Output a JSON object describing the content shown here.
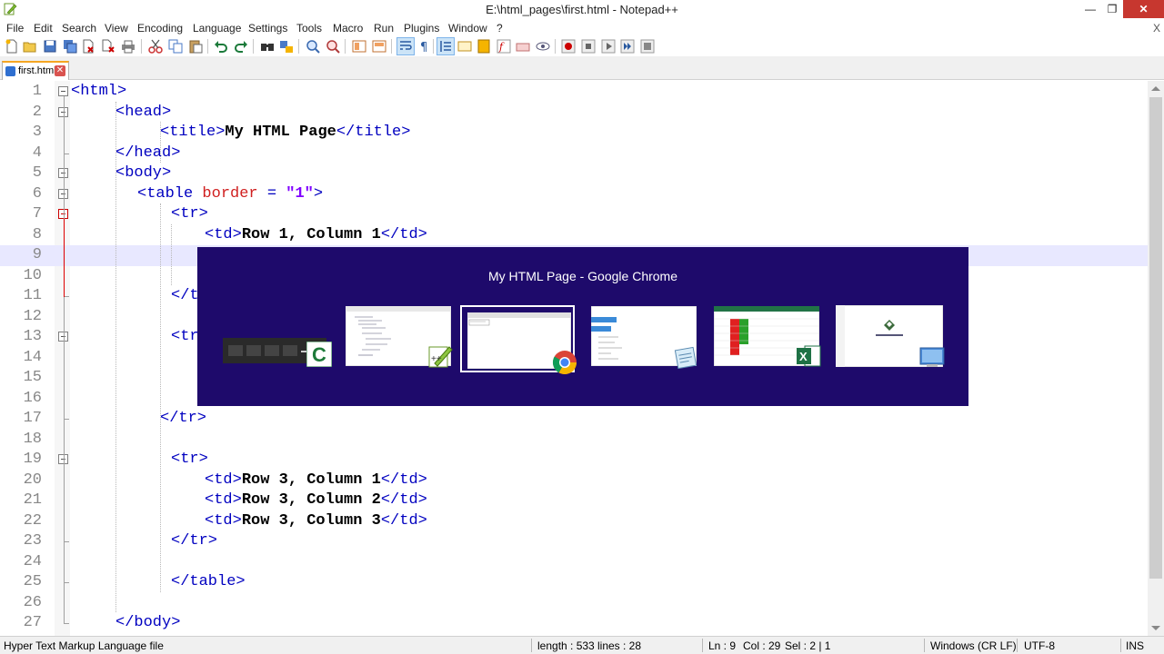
{
  "window": {
    "title": "E:\\html_pages\\first.html - Notepad++",
    "buttons": {
      "minimize": "—",
      "maximize": "❐",
      "close": "✕"
    }
  },
  "menu": {
    "items": [
      "File",
      "Edit",
      "Search",
      "View",
      "Encoding",
      "Language",
      "Settings",
      "Tools",
      "Macro",
      "Run",
      "Plugins",
      "Window",
      "?"
    ],
    "close": "X"
  },
  "toolbar": {
    "icons": [
      "new-file-icon",
      "open-file-icon",
      "save-icon",
      "save-all-icon",
      "close-icon",
      "close-all-icon",
      "print-icon",
      "cut-icon",
      "copy-icon",
      "paste-icon",
      "undo-icon",
      "redo-icon",
      "find-icon",
      "replace-icon",
      "zoom-in-icon",
      "zoom-out-icon",
      "sync-vertical-icon",
      "sync-horizontal-icon",
      "word-wrap-icon",
      "show-all-chars-icon",
      "indent-guide-icon",
      "udl-icon",
      "doc-map-icon",
      "function-list-icon",
      "folder-as-workspace-icon",
      "monitor-icon",
      "record-macro-icon",
      "stop-macro-icon",
      "play-macro-icon",
      "run-macro-multiple-icon",
      "save-macro-icon"
    ]
  },
  "tabs": [
    {
      "label": "first.html",
      "close": "✕"
    }
  ],
  "editor": {
    "current_line": 9,
    "lines": [
      {
        "n": "1",
        "segments": [
          {
            "c": "tag",
            "t": "<html>"
          }
        ]
      },
      {
        "n": "2",
        "segments": [
          {
            "c": "tag",
            "t": "<head>"
          }
        ]
      },
      {
        "n": "3",
        "segments": [
          {
            "c": "tag",
            "t": "<title>"
          },
          {
            "c": "txt",
            "t": "My HTML Page"
          },
          {
            "c": "tag",
            "t": "</title>"
          }
        ]
      },
      {
        "n": "4",
        "segments": [
          {
            "c": "tag",
            "t": "</head>"
          }
        ]
      },
      {
        "n": "5",
        "segments": [
          {
            "c": "tag",
            "t": "<body>"
          }
        ]
      },
      {
        "n": "6",
        "segments": [
          {
            "c": "tag",
            "t": "<table "
          },
          {
            "c": "attr",
            "t": "border"
          },
          {
            "c": "tag",
            "t": " = "
          },
          {
            "c": "val",
            "t": "\"1\""
          },
          {
            "c": "tag",
            "t": ">"
          }
        ]
      },
      {
        "n": "7",
        "segments": [
          {
            "c": "tag",
            "t": "<tr>"
          }
        ]
      },
      {
        "n": "8",
        "segments": [
          {
            "c": "tag",
            "t": "<td>"
          },
          {
            "c": "txt",
            "t": "Row 1, Column 1"
          },
          {
            "c": "tag",
            "t": "</td>"
          }
        ]
      },
      {
        "n": "9",
        "segments": []
      },
      {
        "n": "10",
        "segments": []
      },
      {
        "n": "11",
        "segments": [
          {
            "c": "tag",
            "t": "</tr>"
          }
        ]
      },
      {
        "n": "12",
        "segments": []
      },
      {
        "n": "13",
        "segments": [
          {
            "c": "tag",
            "t": "<tr>"
          }
        ]
      },
      {
        "n": "14",
        "segments": []
      },
      {
        "n": "15",
        "segments": []
      },
      {
        "n": "16",
        "segments": []
      },
      {
        "n": "17",
        "segments": [
          {
            "c": "tag",
            "t": "</tr>"
          }
        ]
      },
      {
        "n": "18",
        "segments": []
      },
      {
        "n": "19",
        "segments": [
          {
            "c": "tag",
            "t": "<tr>"
          }
        ]
      },
      {
        "n": "20",
        "segments": [
          {
            "c": "tag",
            "t": "<td>"
          },
          {
            "c": "txt",
            "t": "Row 3, Column 1"
          },
          {
            "c": "tag",
            "t": "</td>"
          }
        ]
      },
      {
        "n": "21",
        "segments": [
          {
            "c": "tag",
            "t": "<td>"
          },
          {
            "c": "txt",
            "t": "Row 3, Column 2"
          },
          {
            "c": "tag",
            "t": "</td>"
          }
        ]
      },
      {
        "n": "22",
        "segments": [
          {
            "c": "tag",
            "t": "<td>"
          },
          {
            "c": "txt",
            "t": "Row 3, Column 3"
          },
          {
            "c": "tag",
            "t": "</td>"
          }
        ]
      },
      {
        "n": "23",
        "segments": [
          {
            "c": "tag",
            "t": "</tr>"
          }
        ]
      },
      {
        "n": "24",
        "segments": []
      },
      {
        "n": "25",
        "segments": [
          {
            "c": "tag",
            "t": "</table>"
          }
        ]
      },
      {
        "n": "26",
        "segments": []
      },
      {
        "n": "27",
        "segments": [
          {
            "c": "tag",
            "t": "</body>"
          }
        ]
      }
    ]
  },
  "switcher": {
    "title": "My HTML Page - Google Chrome",
    "active_index": 2,
    "apps": [
      {
        "name": "camtasia-thumbnail",
        "badge": "camtasia-icon"
      },
      {
        "name": "notepad-plus-plus-thumbnail",
        "badge": "notepad-plus-plus-icon"
      },
      {
        "name": "google-chrome-thumbnail",
        "badge": "chrome-icon"
      },
      {
        "name": "notepad-thumbnail",
        "badge": "notepad-icon"
      },
      {
        "name": "excel-thumbnail",
        "badge": "excel-icon"
      },
      {
        "name": "desktop-thumbnail",
        "badge": "monitor-icon"
      }
    ]
  },
  "status": {
    "file_type": "Hyper Text Markup Language file",
    "length": "length : 533",
    "lines": "lines : 28",
    "ln": "Ln : 9",
    "col": "Col : 29",
    "sel": "Sel : 2 | 1",
    "eol": "Windows (CR LF)",
    "encoding": "UTF-8",
    "mode": "INS"
  },
  "colors": {
    "switcher_bg": "#1e0a6b",
    "tag": "#0000c0",
    "attr": "#d02020",
    "value": "#8000ff"
  }
}
